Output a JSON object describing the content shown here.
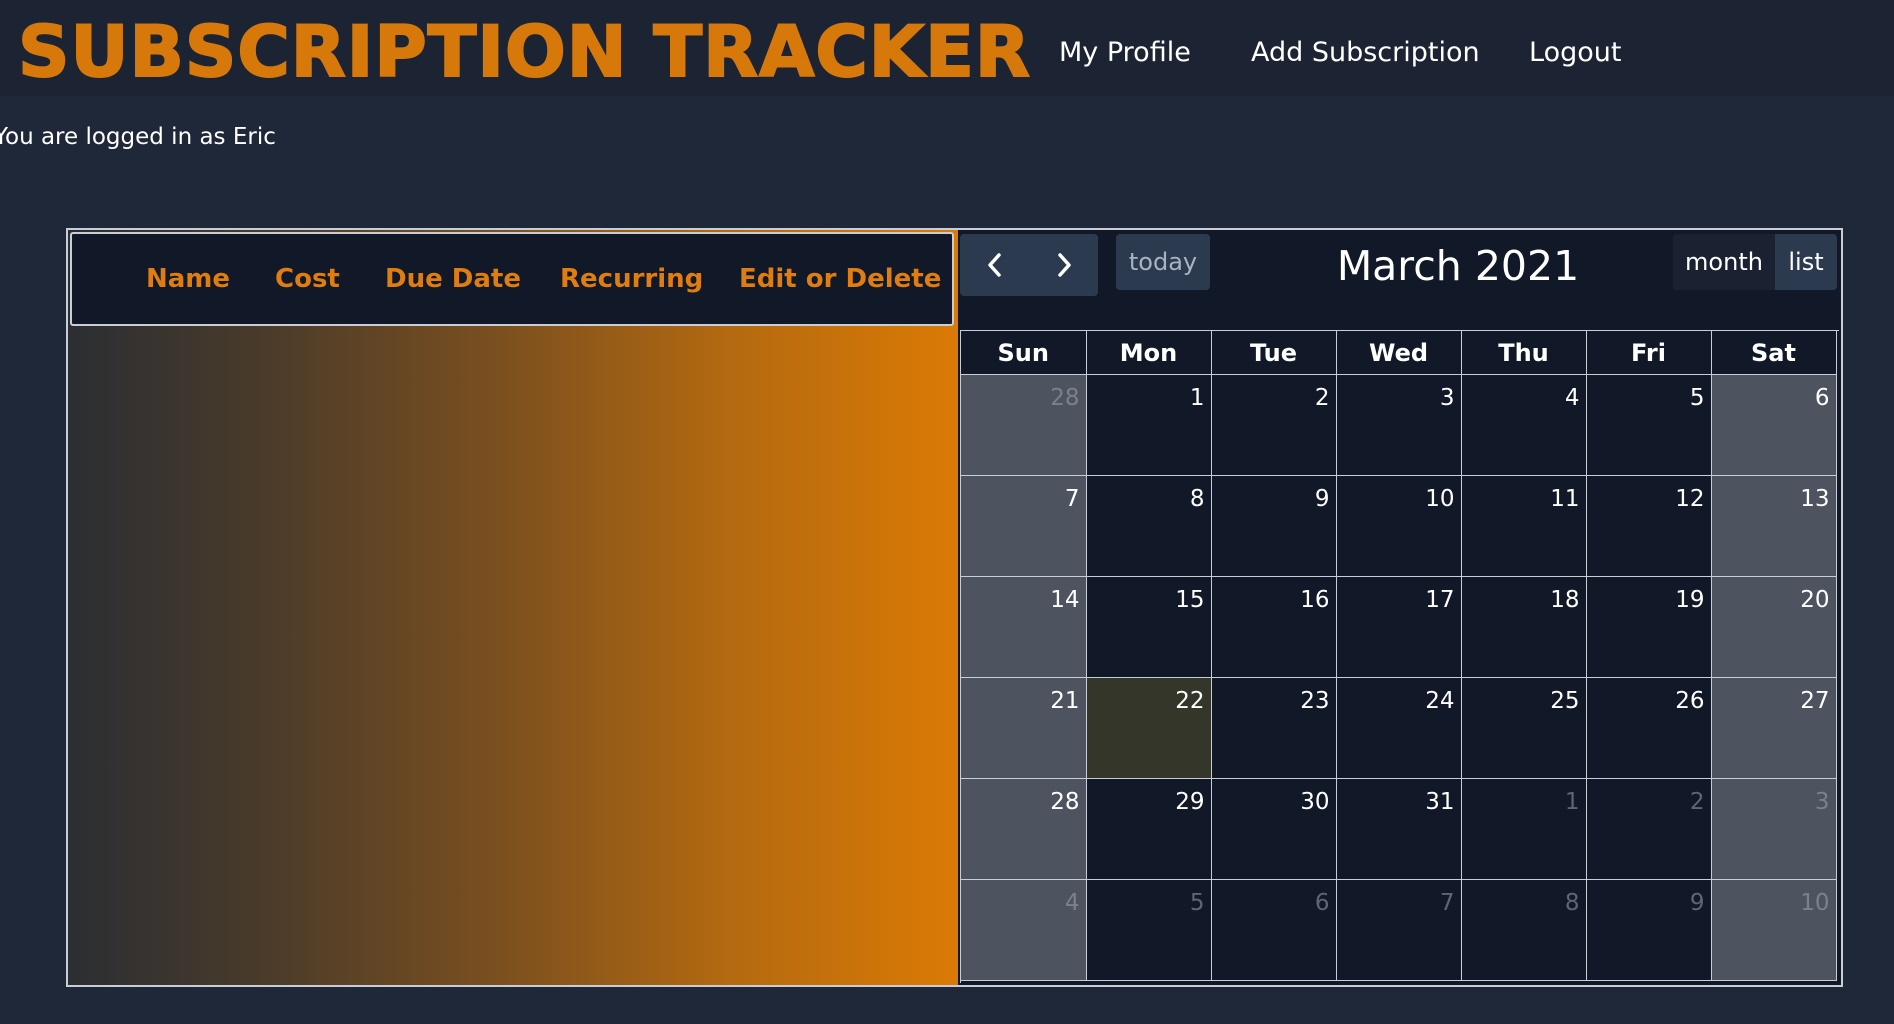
{
  "nav": {
    "brand": "SUBSCRIPTION TRACKER",
    "links": [
      "My Profile",
      "Add Subscription",
      "Logout"
    ]
  },
  "status_text": "You are logged in as Eric",
  "table": {
    "headers": [
      "Name",
      "Cost",
      "Due Date",
      "Recurring",
      "Edit or Delete"
    ]
  },
  "calendar": {
    "title": "March 2021",
    "today_label": "today",
    "prev_icon": "chevron-left-icon",
    "next_icon": "chevron-right-icon",
    "views": [
      "month",
      "list"
    ],
    "weekdays": [
      "Sun",
      "Mon",
      "Tue",
      "Wed",
      "Thu",
      "Fri",
      "Sat"
    ],
    "weeks": [
      [
        {
          "d": "28",
          "other": true
        },
        {
          "d": "1"
        },
        {
          "d": "2"
        },
        {
          "d": "3"
        },
        {
          "d": "4"
        },
        {
          "d": "5"
        },
        {
          "d": "6"
        }
      ],
      [
        {
          "d": "7"
        },
        {
          "d": "8"
        },
        {
          "d": "9"
        },
        {
          "d": "10"
        },
        {
          "d": "11"
        },
        {
          "d": "12"
        },
        {
          "d": "13"
        }
      ],
      [
        {
          "d": "14"
        },
        {
          "d": "15"
        },
        {
          "d": "16"
        },
        {
          "d": "17"
        },
        {
          "d": "18"
        },
        {
          "d": "19"
        },
        {
          "d": "20"
        }
      ],
      [
        {
          "d": "21"
        },
        {
          "d": "22",
          "today": true
        },
        {
          "d": "23"
        },
        {
          "d": "24"
        },
        {
          "d": "25"
        },
        {
          "d": "26"
        },
        {
          "d": "27"
        }
      ],
      [
        {
          "d": "28"
        },
        {
          "d": "29"
        },
        {
          "d": "30"
        },
        {
          "d": "31"
        },
        {
          "d": "1",
          "other": true
        },
        {
          "d": "2",
          "other": true
        },
        {
          "d": "3",
          "other": true
        }
      ],
      [
        {
          "d": "4",
          "other": true
        },
        {
          "d": "5",
          "other": true
        },
        {
          "d": "6",
          "other": true
        },
        {
          "d": "7",
          "other": true
        },
        {
          "d": "8",
          "other": true
        },
        {
          "d": "9",
          "other": true
        },
        {
          "d": "10",
          "other": true
        }
      ]
    ]
  },
  "colors": {
    "accent": "#d6790a",
    "background": "#1f2838",
    "calendar_bg": "#111827",
    "weekend_bg": "#4d535f",
    "today_bg": "#35362a"
  }
}
